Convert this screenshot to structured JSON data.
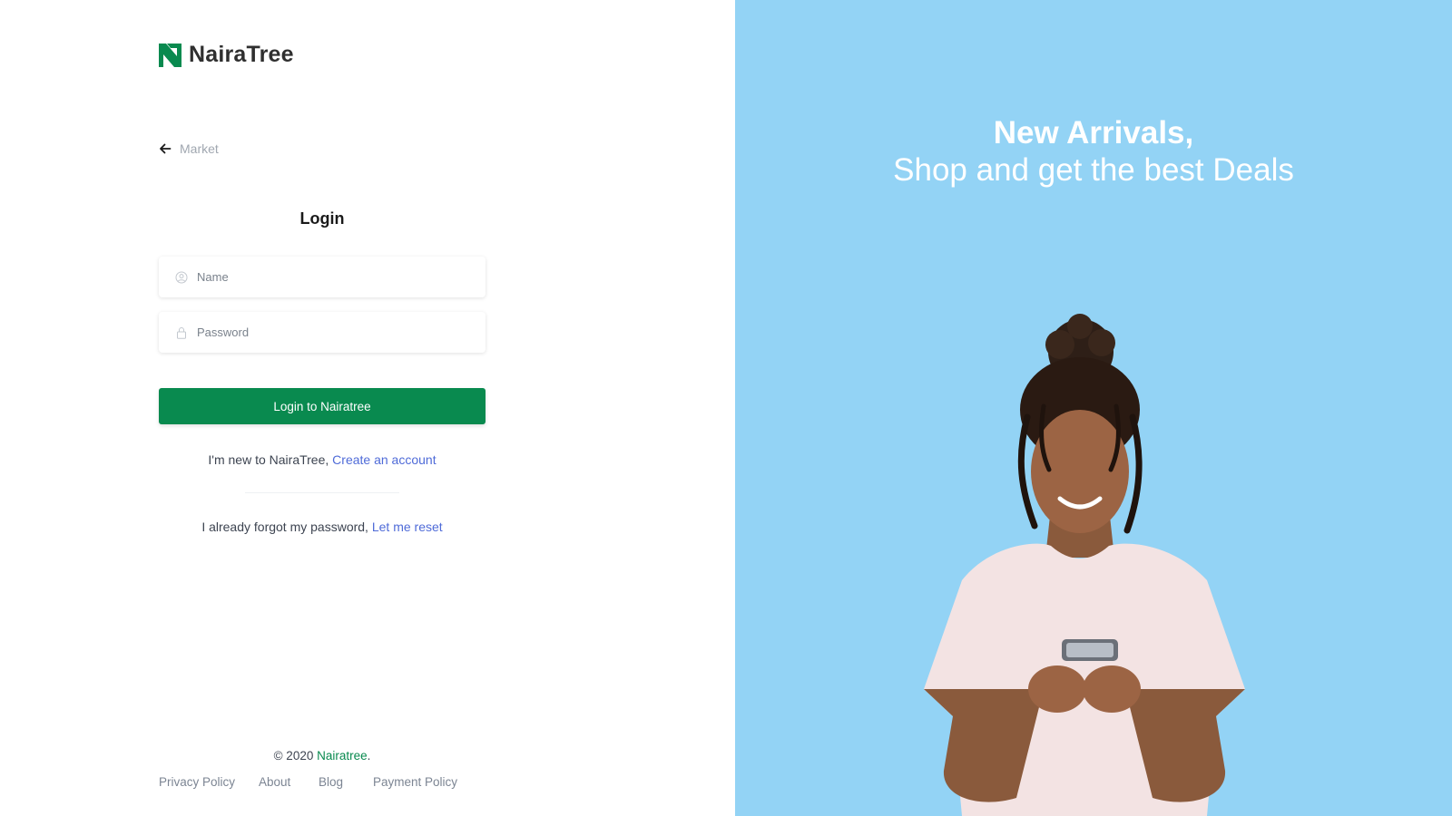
{
  "brand": {
    "name": "NairaTree",
    "accent": "#098a4f"
  },
  "nav": {
    "back_label": "Market",
    "back_icon": "arrow-left-icon"
  },
  "form": {
    "title": "Login",
    "name_placeholder": "Name",
    "name_value": "",
    "name_icon": "user-circle-icon",
    "password_placeholder": "Password",
    "password_value": "",
    "password_icon": "lock-icon",
    "submit_label": "Login to Nairatree"
  },
  "signup": {
    "prefix": "I'm new to NairaTree, ",
    "link": "Create an account"
  },
  "reset": {
    "prefix": "I already forgot my password, ",
    "link": "Let me reset"
  },
  "footer": {
    "copyright_prefix": "© 2020 ",
    "copyright_brand": "Nairatree",
    "copyright_suffix": ".",
    "links": [
      "Privacy Policy",
      "About",
      "Blog",
      "Payment Policy"
    ]
  },
  "hero": {
    "line1": "New Arrivals,",
    "line2": "Shop and get the best Deals",
    "background": "#93d3f5"
  }
}
